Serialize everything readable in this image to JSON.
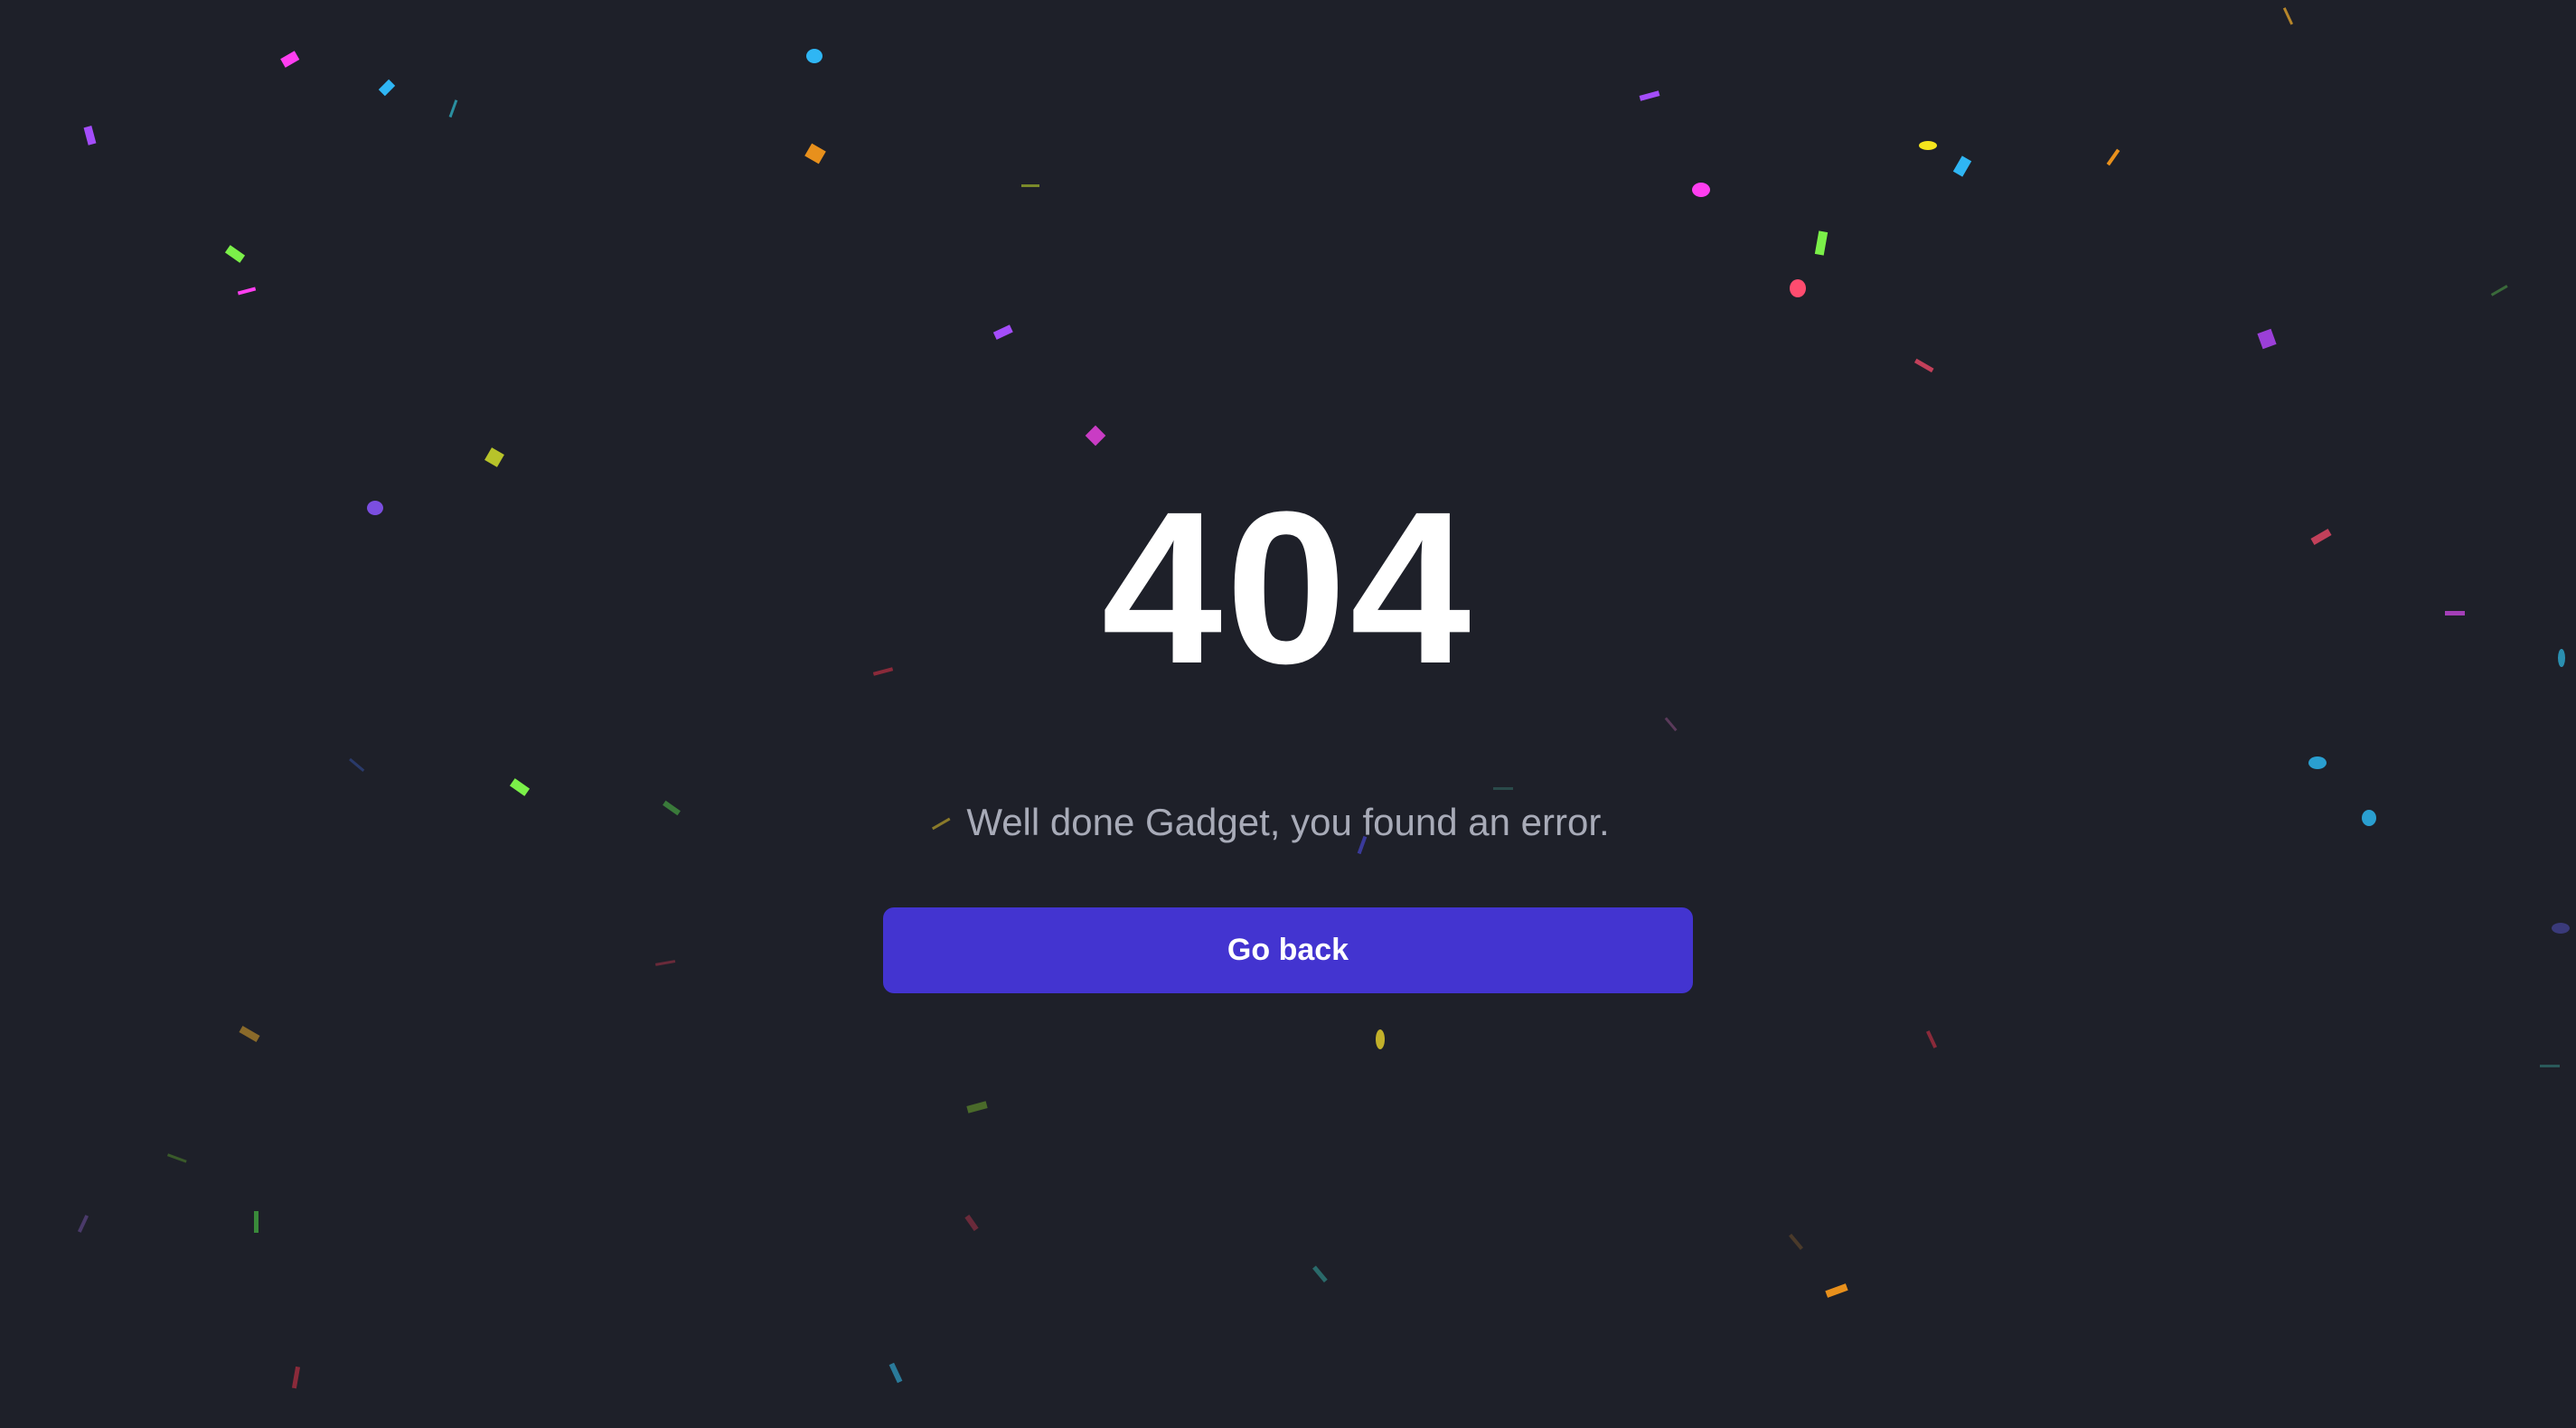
{
  "page": {
    "background_color": "#1e2029"
  },
  "error": {
    "code": "404",
    "message": "Well done Gadget, you found an error."
  },
  "actions": {
    "go_back_label": "Go back",
    "button_color": "#4334d0"
  },
  "confetti": {
    "colors": [
      "#ff3ef0",
      "#2fb6f4",
      "#a44dfb",
      "#e8901c",
      "#7bf049",
      "#f5e51d",
      "#ff4c6f",
      "#9b3fd8",
      "#3fae4d",
      "#c95b8f"
    ]
  }
}
